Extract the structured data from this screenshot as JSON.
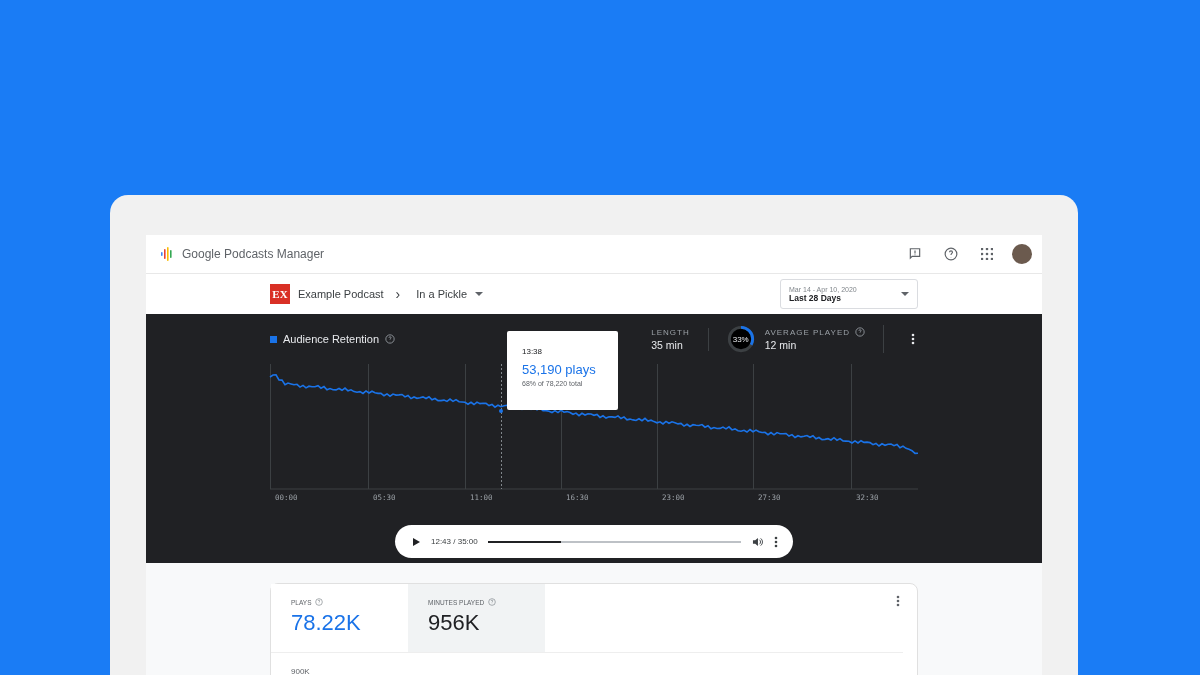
{
  "app_bar": {
    "title": "Google Podcasts Manager"
  },
  "breadcrumb": {
    "podcast_badge": "EX",
    "podcast": "Example Podcast",
    "separator": "›",
    "episode": "In a Pickle"
  },
  "date_range": {
    "range": "Mar 14 - Apr 10, 2020",
    "label": "Last 28 Days"
  },
  "retention": {
    "title": "Audience Retention",
    "stats": [
      {
        "kind": "plain",
        "label": "LENGTH",
        "value": "35 min"
      },
      {
        "kind": "ring",
        "label": "AVERAGE PLAYED",
        "value": "12 min",
        "ring_text": "33%",
        "level": 0.33
      }
    ],
    "x_labels": [
      "00:00",
      "05:30",
      "11:00",
      "16:30",
      "23:00",
      "27:30",
      "32:30"
    ],
    "tooltip": {
      "time": "13:38",
      "plays": "53,190 plays",
      "share": "68% of 78,220 total"
    },
    "player": {
      "time": "12:43 / 35:00",
      "level": 0.29
    }
  },
  "metrics": {
    "tabs": [
      {
        "label": "PLAYS",
        "value": "78.22K",
        "selected": true
      },
      {
        "label": "MINUTES PLAYED",
        "value": "956K",
        "selected": false
      }
    ],
    "axis_label": "900K"
  }
}
